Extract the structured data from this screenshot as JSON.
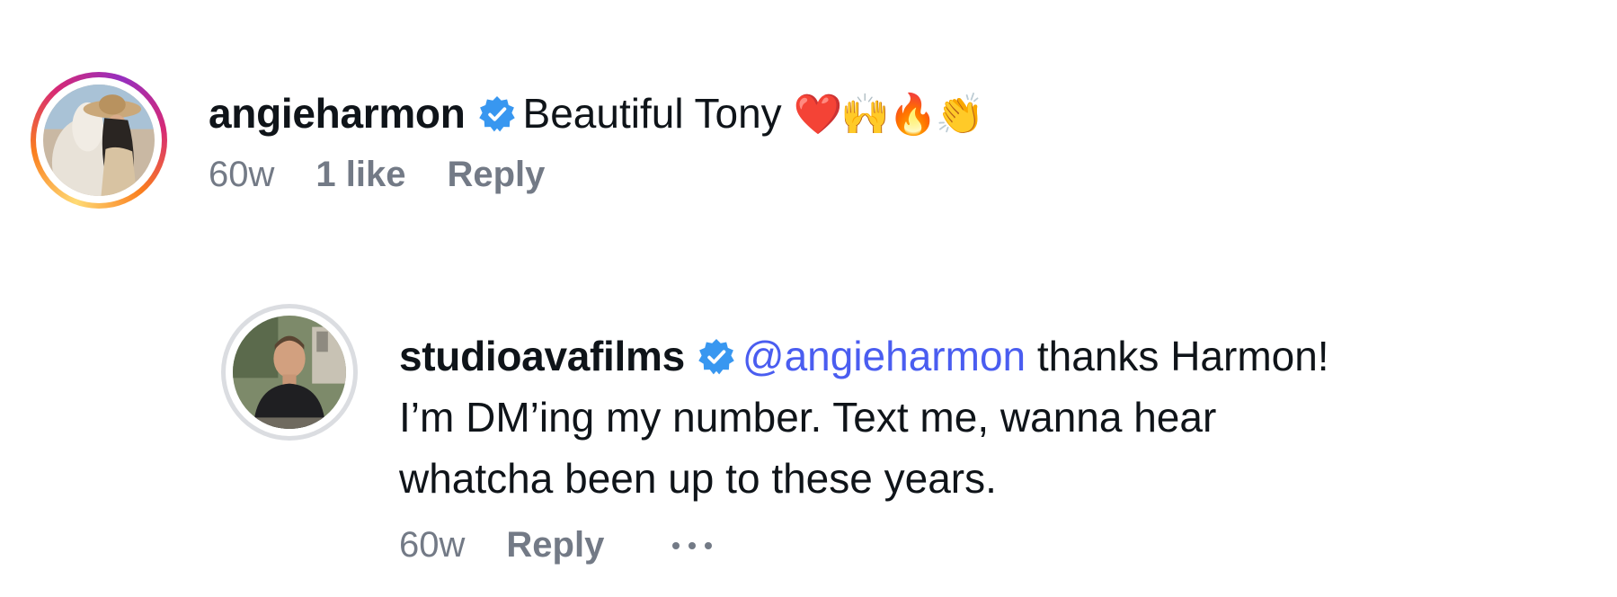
{
  "comments": [
    {
      "username": "angieharmon",
      "verified": true,
      "text": "Beautiful Tony",
      "emojis": "❤️🙌🔥👏",
      "time": "60w",
      "likes": "1 like",
      "reply_label": "Reply"
    },
    {
      "username": "studioavafilms",
      "verified": true,
      "mention": "@angieharmon",
      "text_line1": "thanks Harmon!",
      "text_line2": "I’m DM’ing my number. Text me, wanna hear",
      "text_line3": "whatcha been up to these years.",
      "time": "60w",
      "reply_label": "Reply"
    }
  ],
  "colors": {
    "verified_badge": "#3897f0",
    "mention": "#4a5df0",
    "meta_text": "#737a86"
  },
  "icons": [
    "verified-badge-icon",
    "more-options-icon"
  ]
}
